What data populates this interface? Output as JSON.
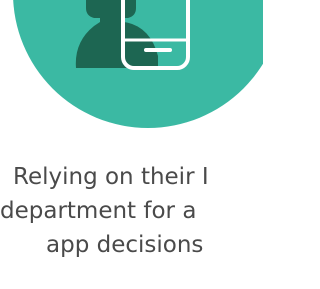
{
  "colors": {
    "badge": "#3bb9a3",
    "person": "#1d6652",
    "phone_outline": "#ffffff",
    "text": "#4a4a4a"
  },
  "icons": {
    "illustration": "person-with-phone-icon"
  },
  "caption": {
    "line1": "Relying on their I",
    "line2": "department for a",
    "line3": "app decisions"
  }
}
